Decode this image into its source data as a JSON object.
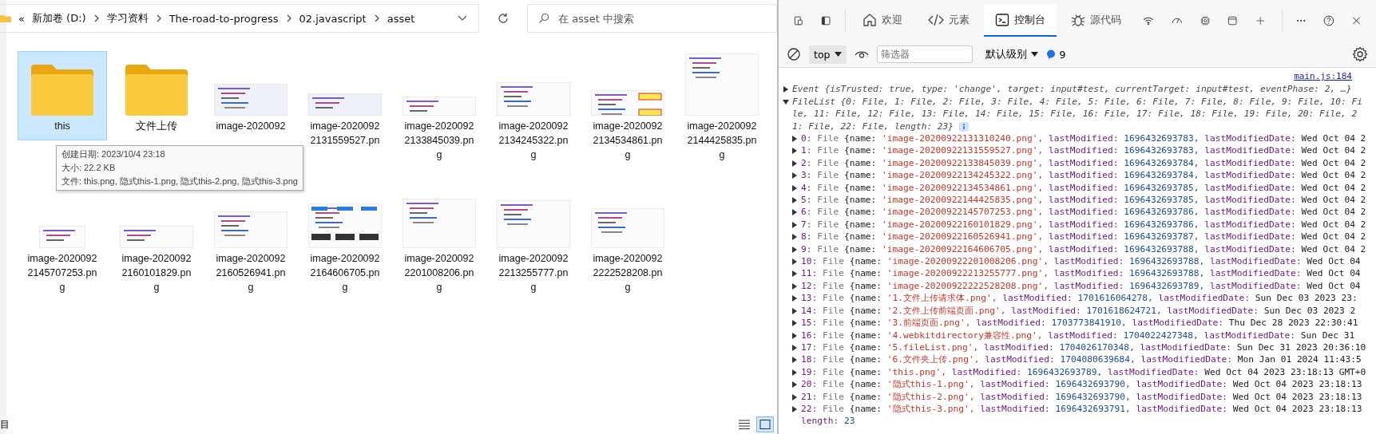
{
  "explorer": {
    "breadcrumb": {
      "overflow": "«",
      "parts": [
        "新加卷 (D:)",
        "学习资料",
        "The-road-to-progress",
        "02.javascript",
        "asset"
      ]
    },
    "search": {
      "placeholder": "在 asset 中搜索"
    },
    "items": [
      {
        "kind": "folder",
        "lines": [
          "this"
        ],
        "selected": true
      },
      {
        "kind": "folder",
        "lines": [
          "文件上传"
        ],
        "selected": false
      },
      {
        "lines": [
          "image-2020092"
        ],
        "selected": false
      },
      {
        "lines": [
          "image-2020092",
          "2131559527.pn"
        ],
        "selected": false
      },
      {
        "lines": [
          "image-2020092",
          "2133845039.pn",
          "g"
        ],
        "selected": false
      },
      {
        "lines": [
          "image-2020092",
          "2134245322.pn",
          "g"
        ],
        "selected": false
      },
      {
        "lines": [
          "image-2020092",
          "2134534861.pn",
          "g"
        ],
        "selected": false
      },
      {
        "lines": [
          "image-2020092",
          "2144425835.pn",
          "g"
        ],
        "selected": false
      },
      {
        "lines": [
          "image-2020092",
          "2145707253.pn",
          "g"
        ],
        "selected": false
      },
      {
        "lines": [
          "image-2020092",
          "2160101829.pn",
          "g"
        ],
        "selected": false
      },
      {
        "lines": [
          "image-2020092",
          "2160526941.pn",
          "g"
        ],
        "selected": false
      },
      {
        "lines": [
          "image-2020092",
          "2164606705.pn",
          "g"
        ],
        "selected": false
      },
      {
        "lines": [
          "image-2020092",
          "2201008206.pn",
          "g"
        ],
        "selected": false
      },
      {
        "lines": [
          "image-2020092",
          "2213255777.pn",
          "g"
        ],
        "selected": false
      },
      {
        "lines": [
          "image-2020092",
          "2222528208.pn",
          "g"
        ],
        "selected": false
      }
    ],
    "tooltip": [
      "创建日期: 2023/10/4 23:18",
      "大小: 22.2 KB",
      "文件: this.png, 隐式this-1.png, 隐式this-2.png, 隐式this-3.png"
    ],
    "status": "目",
    "views": [
      {
        "kind": "details",
        "selected": false
      },
      {
        "kind": "thumbnails",
        "selected": true
      }
    ]
  },
  "devtools": {
    "tabs": [
      {
        "kind": "home",
        "label": "欢迎",
        "selected": false
      },
      {
        "kind": "code",
        "label": "元素",
        "selected": false
      },
      {
        "kind": "console",
        "label": "控制台",
        "selected": true
      },
      {
        "kind": "bug",
        "label": "源代码",
        "selected": false
      }
    ],
    "toolbar": {
      "context": "top",
      "filter_placeholder": "筛选器",
      "level": "默认级别",
      "messages": "9"
    },
    "console": {
      "source": "main.js:184",
      "event": {
        "expanded": false,
        "text": "Event {isTrusted: true, type: 'change', target: input#test, currentTarget: input#test, eventPhase: 2, …}"
      },
      "filelist": {
        "expanded": true,
        "text": "FileList {0: File, 1: File, 2: File, 3: File, 4: File, 5: File, 6: File, 7: File, 8: File, 9: File, 10: File, 11: File, 12: File, 13: File, 14: File, 15: File, 16: File, 17: File, 18: File, 19: File, 20: File, 21: File, 22: File, length: 23}"
      },
      "entries": [
        {
          "expanded": false,
          "index": "0:",
          "type": "File",
          "name_key": "{name:",
          "name": "'image-20200922131310240.png',",
          "modified_key": "lastModified:",
          "modified": "1696432693783,",
          "date_key": "lastModifiedDate:",
          "date": "Wed Oct 04 2"
        },
        {
          "expanded": false,
          "index": "1:",
          "type": "File",
          "name_key": "{name:",
          "name": "'image-20200922131559527.png',",
          "modified_key": "lastModified:",
          "modified": "1696432693783,",
          "date_key": "lastModifiedDate:",
          "date": "Wed Oct 04 2"
        },
        {
          "expanded": false,
          "index": "2:",
          "type": "File",
          "name_key": "{name:",
          "name": "'image-20200922133845039.png',",
          "modified_key": "lastModified:",
          "modified": "1696432693784,",
          "date_key": "lastModifiedDate:",
          "date": "Wed Oct 04 2"
        },
        {
          "expanded": false,
          "index": "3:",
          "type": "File",
          "name_key": "{name:",
          "name": "'image-20200922134245322.png',",
          "modified_key": "lastModified:",
          "modified": "1696432693784,",
          "date_key": "lastModifiedDate:",
          "date": "Wed Oct 04 2"
        },
        {
          "expanded": false,
          "index": "4:",
          "type": "File",
          "name_key": "{name:",
          "name": "'image-20200922134534861.png',",
          "modified_key": "lastModified:",
          "modified": "1696432693785,",
          "date_key": "lastModifiedDate:",
          "date": "Wed Oct 04 2"
        },
        {
          "expanded": false,
          "index": "5:",
          "type": "File",
          "name_key": "{name:",
          "name": "'image-20200922144425835.png',",
          "modified_key": "lastModified:",
          "modified": "1696432693785,",
          "date_key": "lastModifiedDate:",
          "date": "Wed Oct 04 2"
        },
        {
          "expanded": false,
          "index": "6:",
          "type": "File",
          "name_key": "{name:",
          "name": "'image-20200922145707253.png',",
          "modified_key": "lastModified:",
          "modified": "1696432693786,",
          "date_key": "lastModifiedDate:",
          "date": "Wed Oct 04 2"
        },
        {
          "expanded": false,
          "index": "7:",
          "type": "File",
          "name_key": "{name:",
          "name": "'image-20200922160101829.png',",
          "modified_key": "lastModified:",
          "modified": "1696432693786,",
          "date_key": "lastModifiedDate:",
          "date": "Wed Oct 04 2"
        },
        {
          "expanded": false,
          "index": "8:",
          "type": "File",
          "name_key": "{name:",
          "name": "'image-20200922160526941.png',",
          "modified_key": "lastModified:",
          "modified": "1696432693787,",
          "date_key": "lastModifiedDate:",
          "date": "Wed Oct 04 2"
        },
        {
          "expanded": false,
          "index": "9:",
          "type": "File",
          "name_key": "{name:",
          "name": "'image-20200922164606705.png',",
          "modified_key": "lastModified:",
          "modified": "1696432693788,",
          "date_key": "lastModifiedDate:",
          "date": "Wed Oct 04 2"
        },
        {
          "expanded": false,
          "index": "10:",
          "type": "File",
          "name_key": "{name:",
          "name": "'image-20200922201008206.png',",
          "modified_key": "lastModified:",
          "modified": "1696432693788,",
          "date_key": "lastModifiedDate:",
          "date": "Wed Oct 04"
        },
        {
          "expanded": false,
          "index": "11:",
          "type": "File",
          "name_key": "{name:",
          "name": "'image-20200922213255777.png',",
          "modified_key": "lastModified:",
          "modified": "1696432693788,",
          "date_key": "lastModifiedDate:",
          "date": "Wed Oct 04"
        },
        {
          "expanded": false,
          "index": "12:",
          "type": "File",
          "name_key": "{name:",
          "name": "'image-20200922222528208.png',",
          "modified_key": "lastModified:",
          "modified": "1696432693789,",
          "date_key": "lastModifiedDate:",
          "date": "Wed Oct 04"
        },
        {
          "expanded": false,
          "index": "13:",
          "type": "File",
          "name_key": "{name:",
          "name": "'1.文件上传请求体.png',",
          "modified_key": "lastModified:",
          "modified": "1701616064278,",
          "date_key": "lastModifiedDate:",
          "date": "Sun Dec 03 2023 23:"
        },
        {
          "expanded": false,
          "index": "14:",
          "type": "File",
          "name_key": "{name:",
          "name": "'2.文件上传前端页面.png',",
          "modified_key": "lastModified:",
          "modified": "1701618624721,",
          "date_key": "lastModifiedDate:",
          "date": "Sun Dec 03 2023 2"
        },
        {
          "expanded": false,
          "index": "15:",
          "type": "File",
          "name_key": "{name:",
          "name": "'3.前端页面.png',",
          "modified_key": "lastModified:",
          "modified": "1703773841910,",
          "date_key": "lastModifiedDate:",
          "date": "Thu Dec 28 2023 22:30:41"
        },
        {
          "expanded": false,
          "index": "16:",
          "type": "File",
          "name_key": "{name:",
          "name": "'4.webkitdirectory兼容性.png',",
          "modified_key": "lastModified:",
          "modified": "1704022427348,",
          "date_key": "lastModifiedDate:",
          "date": "Sun Dec 31"
        },
        {
          "expanded": false,
          "index": "17:",
          "type": "File",
          "name_key": "{name:",
          "name": "'5.fileList.png',",
          "modified_key": "lastModified:",
          "modified": "1704026170348,",
          "date_key": "lastModifiedDate:",
          "date": "Sun Dec 31 2023 20:36:10"
        },
        {
          "expanded": false,
          "index": "18:",
          "type": "File",
          "name_key": "{name:",
          "name": "'6.文件夹上传.png',",
          "modified_key": "lastModified:",
          "modified": "1704080639684,",
          "date_key": "lastModifiedDate:",
          "date": "Mon Jan 01 2024 11:43:5"
        },
        {
          "expanded": false,
          "index": "19:",
          "type": "File",
          "name_key": "{name:",
          "name": "'this.png',",
          "modified_key": "lastModified:",
          "modified": "1696432693789,",
          "date_key": "lastModifiedDate:",
          "date": "Wed Oct 04 2023 23:18:13 GMT+0"
        },
        {
          "expanded": false,
          "index": "20:",
          "type": "File",
          "name_key": "{name:",
          "name": "'隐式this-1.png',",
          "modified_key": "lastModified:",
          "modified": "1696432693790,",
          "date_key": "lastModifiedDate:",
          "date": "Wed Oct 04 2023 23:18:13"
        },
        {
          "expanded": false,
          "index": "21:",
          "type": "File",
          "name_key": "{name:",
          "name": "'隐式this-2.png',",
          "modified_key": "lastModified:",
          "modified": "1696432693790,",
          "date_key": "lastModifiedDate:",
          "date": "Wed Oct 04 2023 23:18:13"
        },
        {
          "expanded": false,
          "index": "22:",
          "type": "File",
          "name_key": "{name:",
          "name": "'隐式this-3.png',",
          "modified_key": "lastModified:",
          "modified": "1696432693791,",
          "date_key": "lastModifiedDate:",
          "date": "Wed Oct 04 2023 23:18:13"
        }
      ],
      "length": {
        "key": "length:",
        "value": "23"
      }
    }
  }
}
